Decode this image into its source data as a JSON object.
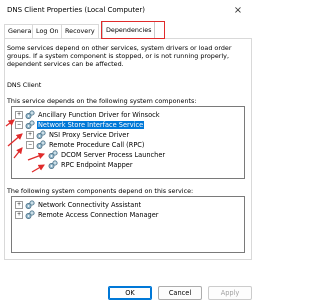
{
  "window": {
    "title": "DNS Client Properties (Local Computer)",
    "close_glyph": "×"
  },
  "tabs": [
    {
      "label": "General",
      "active": false
    },
    {
      "label": "Log On",
      "active": false
    },
    {
      "label": "Recovery",
      "active": false
    },
    {
      "label": "Dependencies",
      "active": true
    }
  ],
  "description": "Some services depend on other services, system drivers or load order groups. If a system component is stopped, or is not running properly, dependent services can be affected.",
  "service_name": "DNS Client",
  "depends_on": {
    "label": "This service depends on the following system components:",
    "items": [
      {
        "label": "Ancillary Function Driver for Winsock",
        "toggle": "+",
        "level": 0,
        "selected": false
      },
      {
        "label": "Network Store Interface Service",
        "toggle": "−",
        "level": 0,
        "selected": true
      },
      {
        "label": "NSI Proxy Service Driver",
        "toggle": "+",
        "level": 1,
        "selected": false
      },
      {
        "label": "Remote Procedure Call (RPC)",
        "toggle": "−",
        "level": 1,
        "selected": false
      },
      {
        "label": "DCOM Server Process Launcher",
        "toggle": "",
        "level": 2,
        "selected": false
      },
      {
        "label": "RPC Endpoint Mapper",
        "toggle": "",
        "level": 2,
        "selected": false
      }
    ]
  },
  "dependents": {
    "label": "The following system components depend on this service:",
    "items": [
      {
        "label": "Network Connectivity Assistant",
        "toggle": "+",
        "level": 0
      },
      {
        "label": "Remote Access Connection Manager",
        "toggle": "+",
        "level": 0
      }
    ]
  },
  "buttons": {
    "ok": "OK",
    "cancel": "Cancel",
    "apply": "Apply"
  },
  "colors": {
    "selection": "#0078d7",
    "annotation": "#e02b2b"
  }
}
